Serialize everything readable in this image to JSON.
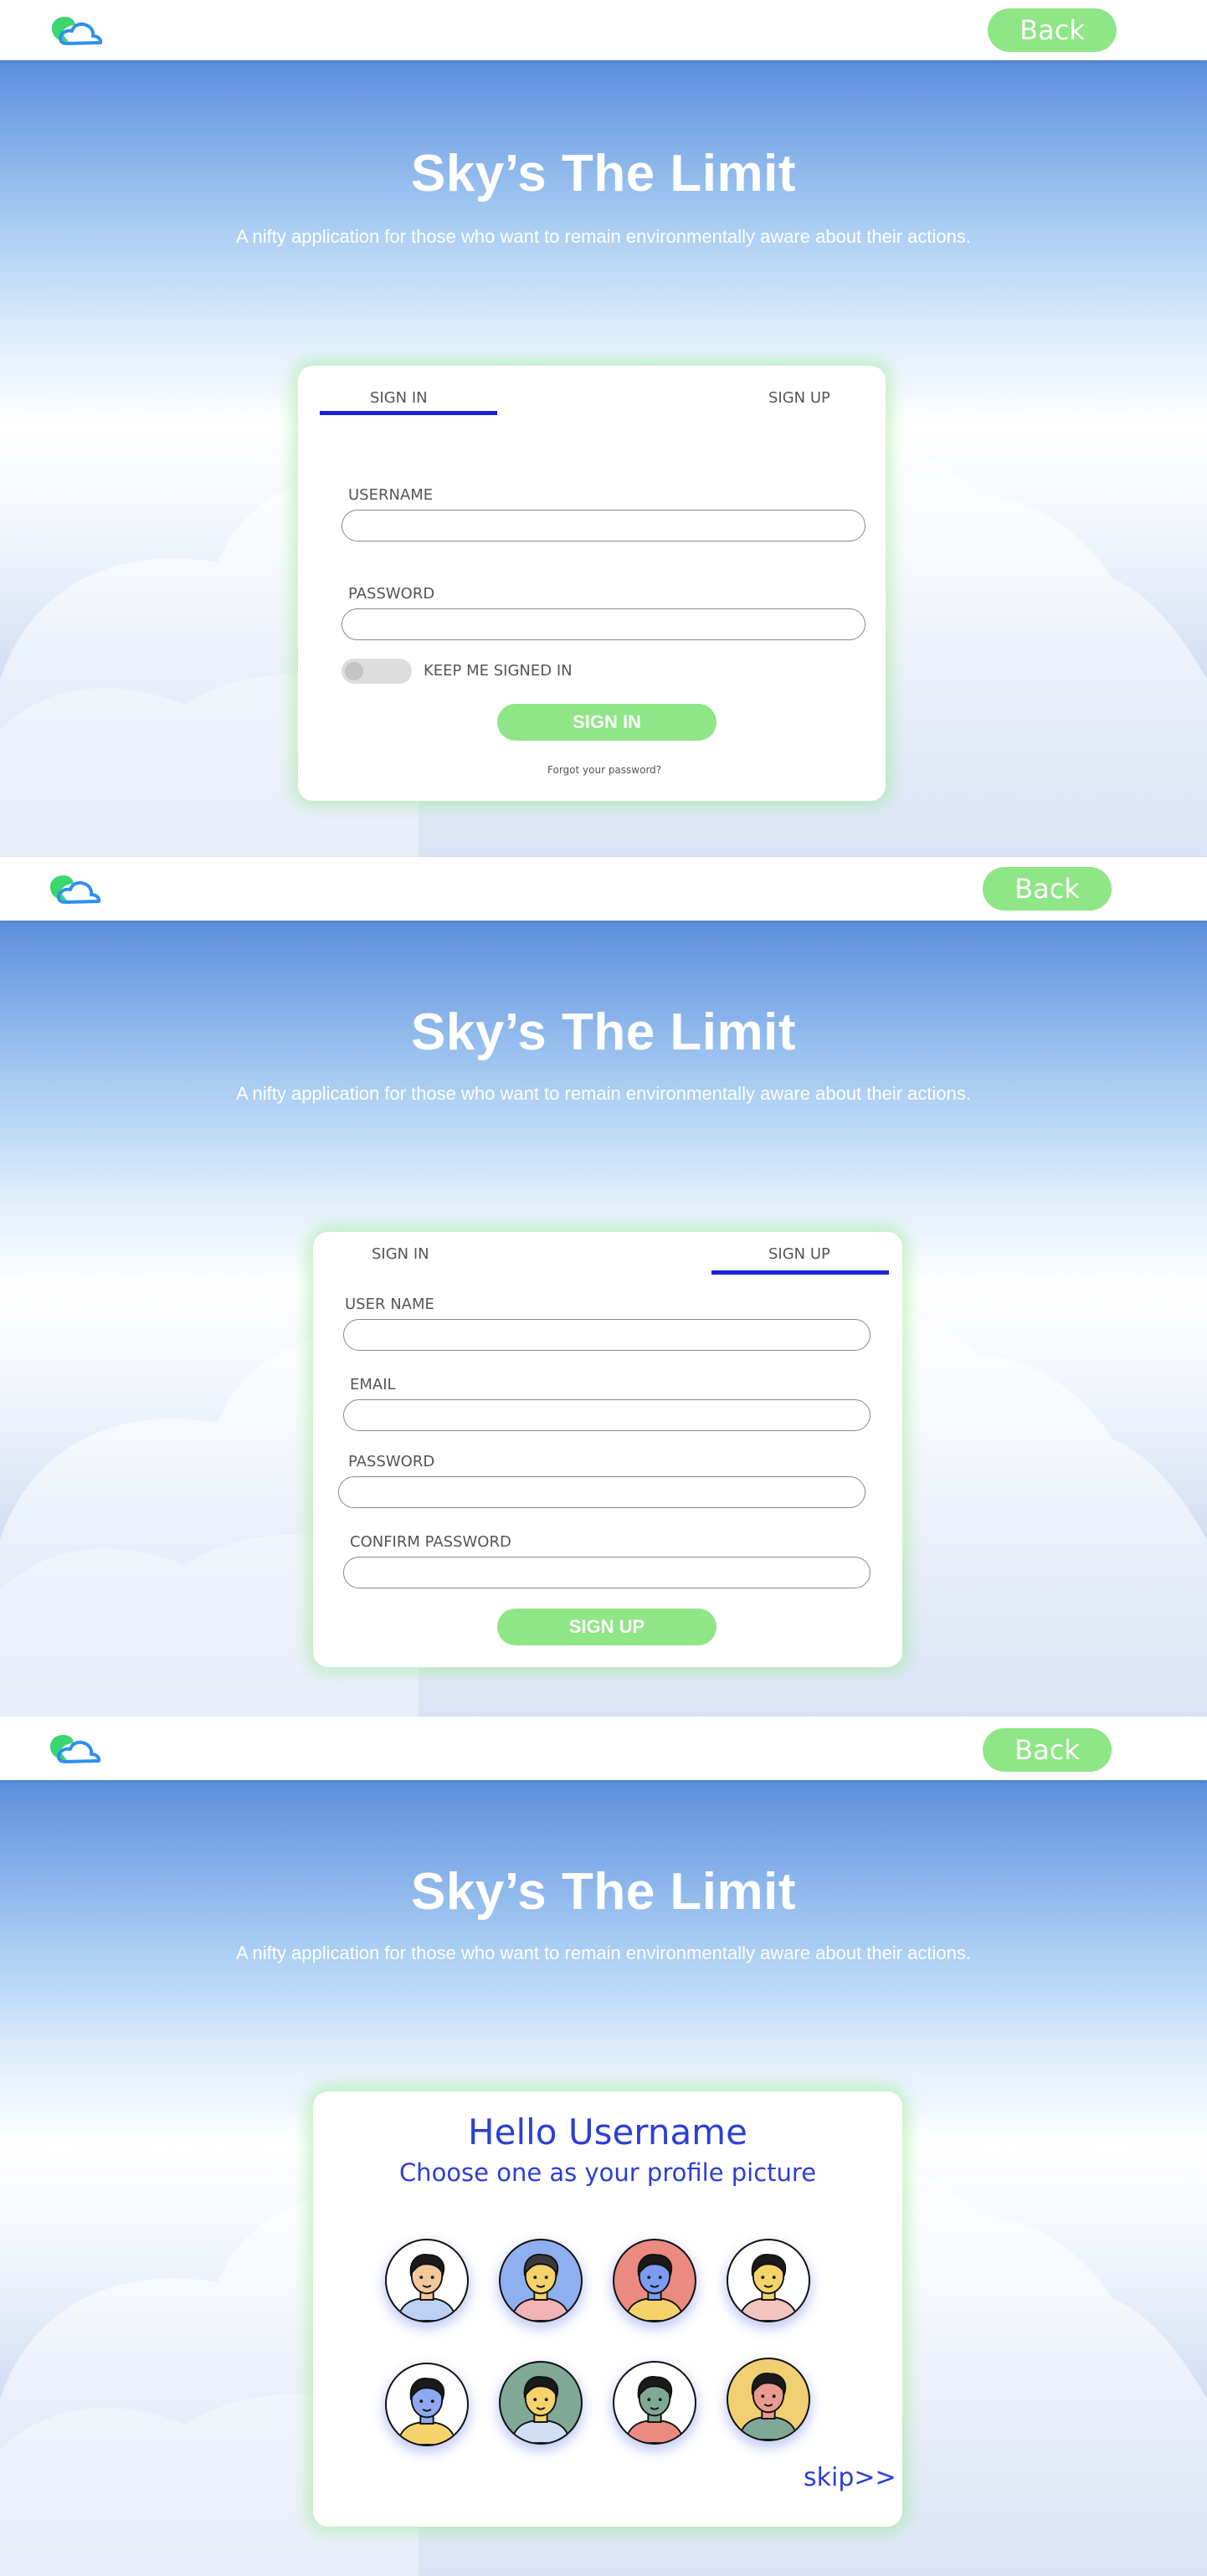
{
  "colors": {
    "accent_green": "#8ee686",
    "tab_underline": "#1a22d8",
    "text_blue": "#2b3fd6",
    "sky_top": "#5b8ede",
    "label_gray": "#555555"
  },
  "header": {
    "logo_icon": "leaf-cloud-logo-icon",
    "back_label": "Back"
  },
  "hero": {
    "title": "Sky’s The Limit",
    "subtitle": "A nifty application for those who want to remain environmentally aware about their actions."
  },
  "signin_screen": {
    "tabs": [
      {
        "label": "SIGN IN",
        "active": true
      },
      {
        "label": "SIGN UP",
        "active": false
      }
    ],
    "fields": [
      {
        "label": "USERNAME",
        "value": ""
      },
      {
        "label": "PASSWORD",
        "value": ""
      }
    ],
    "keep_signed_in_label": "KEEP ME SIGNED IN",
    "keep_signed_in_on": false,
    "submit_label": "SIGN IN",
    "forgot_label": "Forgot your password?"
  },
  "signup_screen": {
    "tabs": [
      {
        "label": "SIGN IN",
        "active": false
      },
      {
        "label": "SIGN UP",
        "active": true
      }
    ],
    "fields": [
      {
        "label": "USER NAME",
        "value": ""
      },
      {
        "label": "EMAIL",
        "value": ""
      },
      {
        "label": "PASSWORD",
        "value": ""
      },
      {
        "label": "CONFIRM PASSWORD",
        "value": ""
      }
    ],
    "submit_label": "SIGN UP"
  },
  "avatar_screen": {
    "greeting": "Hello Username",
    "prompt": "Choose one as your profile picture",
    "avatars": [
      {
        "icon": "bearded-man-avatar-icon",
        "bg": "#ffffff",
        "skin": "#f3c89c",
        "hair": "#1a1a1a",
        "shirt": "#bcd0f2"
      },
      {
        "icon": "man-with-glasses-avatar-icon",
        "bg": "#8fb0ee",
        "skin": "#f5d36a",
        "hair": "#3a3a3a",
        "shirt": "#f1b3b3"
      },
      {
        "icon": "woman-ponytail-avatar-icon",
        "bg": "#ea8a80",
        "skin": "#7b9cf0",
        "hair": "#1a1a1a",
        "shirt": "#f5d36a"
      },
      {
        "icon": "man-curly-hair-avatar-icon",
        "bg": "#ffffff",
        "skin": "#f5d36a",
        "hair": "#1a1a1a",
        "shirt": "#f4c4be"
      },
      {
        "icon": "woman-bun-avatar-icon",
        "bg": "#ffffff",
        "skin": "#8fa8f2",
        "hair": "#1a1a1a",
        "shirt": "#f5d36a"
      },
      {
        "icon": "woman-earrings-avatar-icon",
        "bg": "#7fa896",
        "skin": "#f5d36a",
        "hair": "#1a1a1a",
        "shirt": "#cfe0f5"
      },
      {
        "icon": "woman-short-hair-avatar-icon",
        "bg": "#ffffff",
        "skin": "#7fa896",
        "hair": "#1a1a1a",
        "shirt": "#ea8a80"
      },
      {
        "icon": "woman-long-hair-avatar-icon",
        "bg": "#f0cf72",
        "skin": "#ea9a90",
        "hair": "#1a1a1a",
        "shirt": "#7fa896"
      }
    ],
    "skip_label": "skip>>"
  }
}
